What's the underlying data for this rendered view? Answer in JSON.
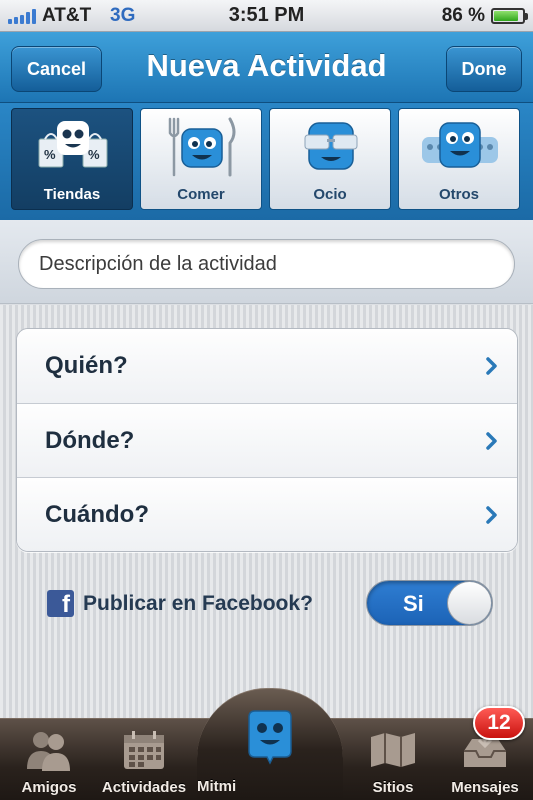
{
  "status_bar": {
    "carrier": "AT&T",
    "network": "3G",
    "time": "3:51 PM",
    "battery_pct": "86 %",
    "battery_level": 0.86
  },
  "nav": {
    "cancel_label": "Cancel",
    "title": "Nueva Actividad",
    "done_label": "Done"
  },
  "categories": [
    {
      "label": "Tiendas",
      "icon": "shopping-bags-icon",
      "selected": true
    },
    {
      "label": "Comer",
      "icon": "fork-knife-icon",
      "selected": false
    },
    {
      "label": "Ocio",
      "icon": "sunglasses-mascot-icon",
      "selected": false
    },
    {
      "label": "Otros",
      "icon": "mascots-icon",
      "selected": false
    }
  ],
  "description": {
    "placeholder": "Descripción de la actividad"
  },
  "rows": [
    {
      "label": "Quién?"
    },
    {
      "label": "Dónde?"
    },
    {
      "label": "Cuándo?"
    }
  ],
  "facebook": {
    "label": "Publicar en Facebook?",
    "toggle_label": "Si",
    "toggle_on": true
  },
  "tabbar": {
    "items": [
      {
        "label": "Amigos",
        "icon": "people-icon"
      },
      {
        "label": "Actividades",
        "icon": "calendar-icon"
      },
      {
        "label": "Mitmi",
        "icon": "mitmi-mascot-icon"
      },
      {
        "label": "Sitios",
        "icon": "map-icon"
      },
      {
        "label": "Mensajes",
        "icon": "inbox-icon"
      }
    ],
    "messages_badge": "12"
  },
  "colors": {
    "accent_blue": "#1d75b4",
    "badge_red": "#e5201c",
    "facebook_blue": "#3b5998"
  }
}
